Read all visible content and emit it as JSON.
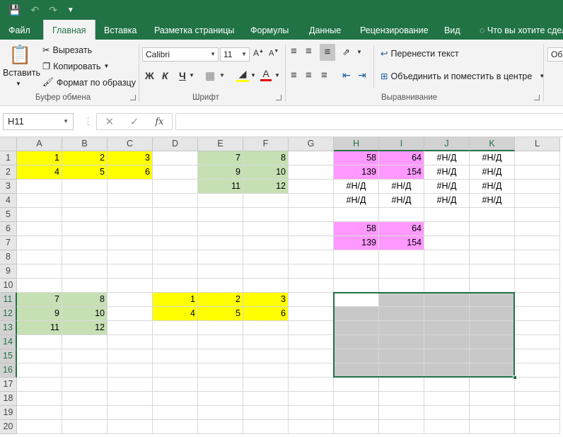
{
  "qat": {
    "save_icon": "save-icon",
    "undo_icon": "undo-icon",
    "redo_icon": "redo-icon",
    "customize_icon": "customize-qat-icon"
  },
  "tabs": [
    "Файл",
    "Главная",
    "Вставка",
    "Разметка страницы",
    "Формулы",
    "Данные",
    "Рецензирование",
    "Вид",
    "Что вы хотите сдел"
  ],
  "ribbon": {
    "clipboard": {
      "paste": "Вставить",
      "cut": "Вырезать",
      "copy": "Копировать",
      "format_painter": "Формат по образцу",
      "label": "Буфер обмена"
    },
    "font": {
      "name": "Calibri",
      "size": "11",
      "bold": "Ж",
      "italic": "К",
      "underline": "Ч",
      "label": "Шрифт"
    },
    "alignment": {
      "wrap": "Перенести текст",
      "merge": "Объединить и поместить в центре",
      "label": "Выравнивание"
    },
    "number_format_partial": "Обш"
  },
  "formula_bar": {
    "name_box": "H11",
    "fx": "fx",
    "formula": ""
  },
  "columns": [
    "A",
    "B",
    "C",
    "D",
    "E",
    "F",
    "G",
    "H",
    "I",
    "J",
    "K",
    "L"
  ],
  "rows": [
    "1",
    "2",
    "3",
    "4",
    "5",
    "6",
    "7",
    "8",
    "9",
    "10",
    "11",
    "12",
    "13",
    "14",
    "15",
    "16",
    "17",
    "18",
    "19",
    "20"
  ],
  "colors": {
    "yellow": "#ffff00",
    "green": "#c6e0b4",
    "pink": "#ff99ff",
    "gray": "#c8c8c8",
    "accent": "#217346"
  },
  "cells": [
    {
      "ref": "A1",
      "v": "1",
      "bg": "yellow"
    },
    {
      "ref": "B1",
      "v": "2",
      "bg": "yellow"
    },
    {
      "ref": "C1",
      "v": "3",
      "bg": "yellow"
    },
    {
      "ref": "A2",
      "v": "4",
      "bg": "yellow"
    },
    {
      "ref": "B2",
      "v": "5",
      "bg": "yellow"
    },
    {
      "ref": "C2",
      "v": "6",
      "bg": "yellow"
    },
    {
      "ref": "E1",
      "v": "7",
      "bg": "green"
    },
    {
      "ref": "F1",
      "v": "8",
      "bg": "green"
    },
    {
      "ref": "E2",
      "v": "9",
      "bg": "green"
    },
    {
      "ref": "F2",
      "v": "10",
      "bg": "green"
    },
    {
      "ref": "E3",
      "v": "11",
      "bg": "green"
    },
    {
      "ref": "F3",
      "v": "12",
      "bg": "green"
    },
    {
      "ref": "H1",
      "v": "58",
      "bg": "pink"
    },
    {
      "ref": "I1",
      "v": "64",
      "bg": "pink"
    },
    {
      "ref": "J1",
      "v": "#Н/Д",
      "ctr": true
    },
    {
      "ref": "K1",
      "v": "#Н/Д",
      "ctr": true
    },
    {
      "ref": "H2",
      "v": "139",
      "bg": "pink"
    },
    {
      "ref": "I2",
      "v": "154",
      "bg": "pink"
    },
    {
      "ref": "J2",
      "v": "#Н/Д",
      "ctr": true
    },
    {
      "ref": "K2",
      "v": "#Н/Д",
      "ctr": true
    },
    {
      "ref": "H3",
      "v": "#Н/Д",
      "ctr": true
    },
    {
      "ref": "I3",
      "v": "#Н/Д",
      "ctr": true
    },
    {
      "ref": "J3",
      "v": "#Н/Д",
      "ctr": true
    },
    {
      "ref": "K3",
      "v": "#Н/Д",
      "ctr": true
    },
    {
      "ref": "H4",
      "v": "#Н/Д",
      "ctr": true
    },
    {
      "ref": "I4",
      "v": "#Н/Д",
      "ctr": true
    },
    {
      "ref": "J4",
      "v": "#Н/Д",
      "ctr": true
    },
    {
      "ref": "K4",
      "v": "#Н/Д",
      "ctr": true
    },
    {
      "ref": "H6",
      "v": "58",
      "bg": "pink"
    },
    {
      "ref": "I6",
      "v": "64",
      "bg": "pink"
    },
    {
      "ref": "H7",
      "v": "139",
      "bg": "pink"
    },
    {
      "ref": "I7",
      "v": "154",
      "bg": "pink"
    },
    {
      "ref": "A11",
      "v": "7",
      "bg": "green"
    },
    {
      "ref": "B11",
      "v": "8",
      "bg": "green"
    },
    {
      "ref": "A12",
      "v": "9",
      "bg": "green"
    },
    {
      "ref": "B12",
      "v": "10",
      "bg": "green"
    },
    {
      "ref": "A13",
      "v": "11",
      "bg": "green"
    },
    {
      "ref": "B13",
      "v": "12",
      "bg": "green"
    },
    {
      "ref": "D11",
      "v": "1",
      "bg": "yellow"
    },
    {
      "ref": "E11",
      "v": "2",
      "bg": "yellow"
    },
    {
      "ref": "F11",
      "v": "3",
      "bg": "yellow"
    },
    {
      "ref": "D12",
      "v": "4",
      "bg": "yellow"
    },
    {
      "ref": "E12",
      "v": "5",
      "bg": "yellow"
    },
    {
      "ref": "F12",
      "v": "6",
      "bg": "yellow"
    }
  ],
  "selection": {
    "active": "H11",
    "range": "H11:K16"
  }
}
